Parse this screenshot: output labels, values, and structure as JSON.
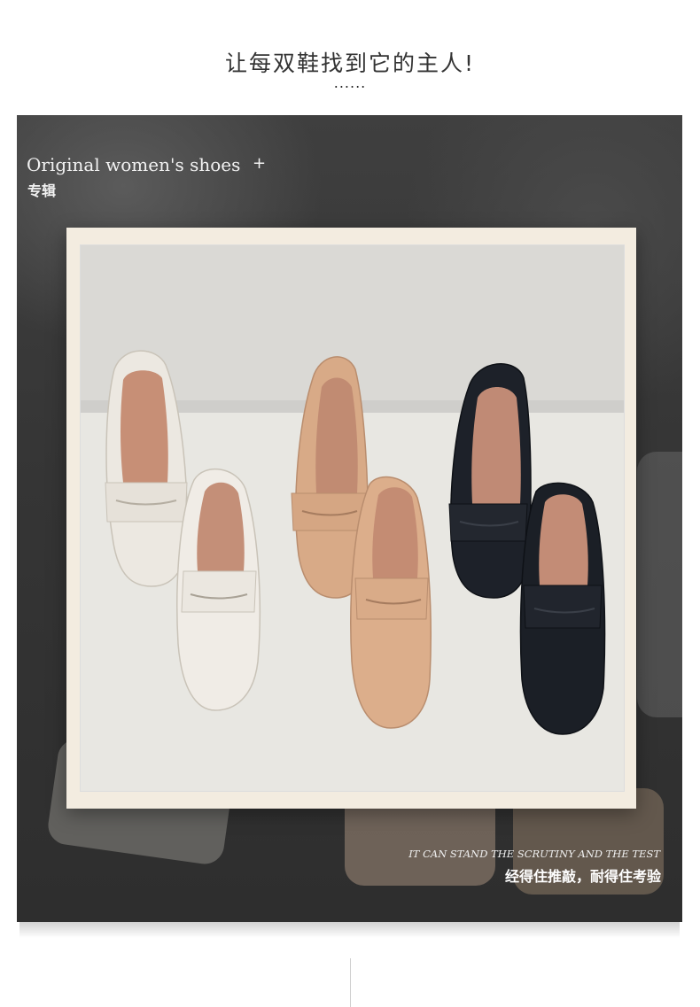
{
  "page": {
    "headline": "让每双鞋找到它的主人!",
    "dots": "......"
  },
  "hero": {
    "title": "Original women's shoes",
    "plus": "+",
    "subtitle": "专辑",
    "caption_en": "IT CAN STAND THE SCRUTINY AND THE TEST",
    "caption_cn": "经得住推敲，耐得住考验"
  },
  "colors": {
    "background": "#ffffff",
    "hero_dark": "#363636",
    "frame_cream": "#f3ece0",
    "shoe_white": "#ece8e0",
    "shoe_tan": "#d9ab88",
    "shoe_black": "#1b1f26",
    "insole": "#c48f78"
  },
  "icons": {
    "plus": "plus-icon"
  }
}
